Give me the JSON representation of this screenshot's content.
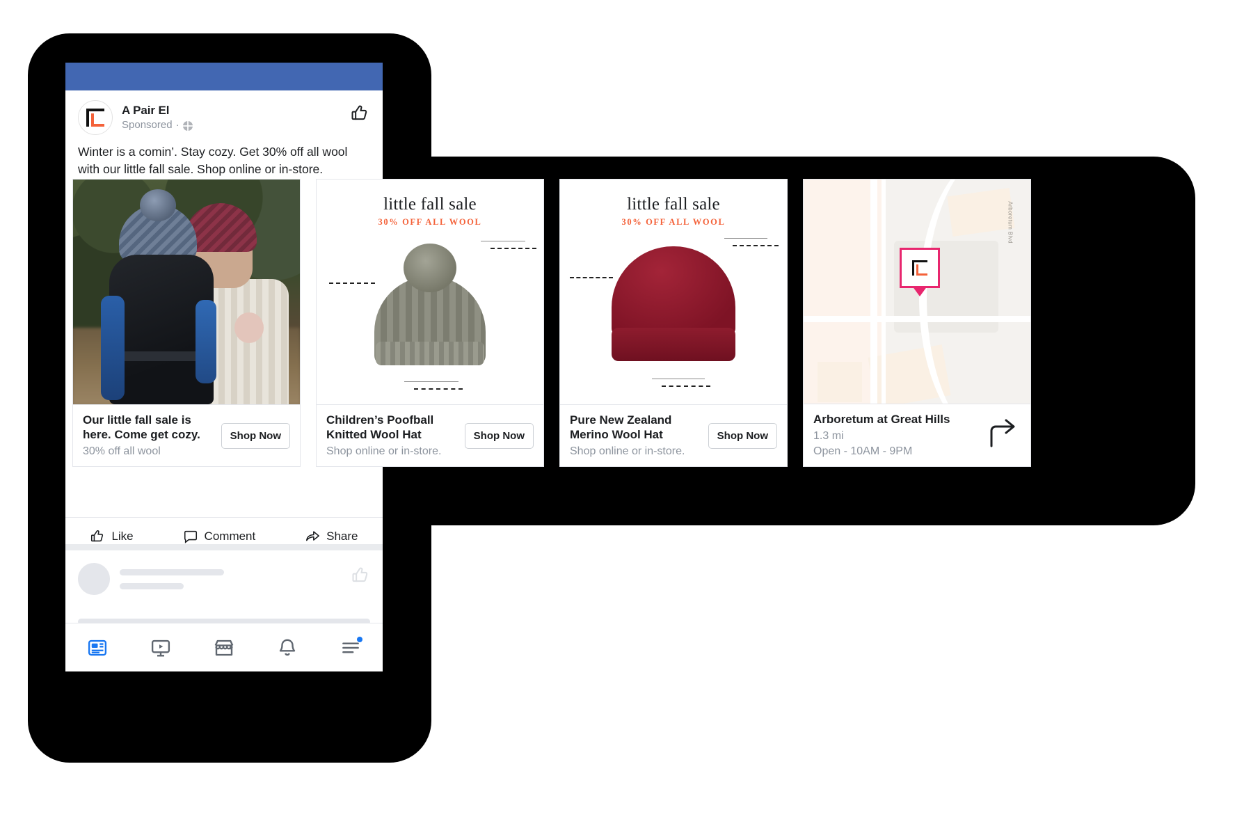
{
  "post": {
    "page_name": "A Pair El",
    "sponsored_label": "Sponsored",
    "sponsored_separator": "·",
    "globe_icon": "globe-icon",
    "thumbs_up_icon": "thumbs-up-icon",
    "caption": "Winter is a comin’. Stay cozy. Get 30% off all wool with our little fall sale. Shop online or in-store."
  },
  "cards": [
    {
      "kind": "photo",
      "title": "Our little fall sale is here. Come get cozy.",
      "subtitle": "30% off all wool",
      "cta": "Shop Now",
      "media_alt": "two-people-hiking-photo"
    },
    {
      "kind": "product",
      "sale_title": "little fall sale",
      "sale_sub": "30% OFF ALL WOOL",
      "title": "Children’s Poofball Knitted Wool Hat",
      "subtitle": "Shop online or in-store.",
      "cta": "Shop Now",
      "media_alt": "grey-pompom-beanie"
    },
    {
      "kind": "product",
      "sale_title": "little fall sale",
      "sale_sub": "30% OFF ALL WOOL",
      "title": "Pure New Zealand Merino Wool Hat",
      "subtitle": "Shop online or in-store.",
      "cta": "Shop Now",
      "media_alt": "red-merino-beanie"
    },
    {
      "kind": "map",
      "title": "Arboretum at Great Hills",
      "distance": "1.3 mi",
      "hours": "Open - 10AM - 9PM",
      "street_label": "Arboretum Blvd",
      "direction_icon": "turn-right-arrow-icon",
      "media_alt": "store-location-map"
    }
  ],
  "engagement": [
    {
      "label": "Like",
      "icon": "thumbs-up-icon"
    },
    {
      "label": "Comment",
      "icon": "comment-bubble-icon"
    },
    {
      "label": "Share",
      "icon": "share-arrow-icon"
    }
  ],
  "bottom_nav": [
    {
      "name": "news-feed",
      "icon": "news-feed-icon",
      "active": true
    },
    {
      "name": "watch",
      "icon": "watch-video-icon",
      "active": false
    },
    {
      "name": "marketplace",
      "icon": "marketplace-store-icon",
      "active": false
    },
    {
      "name": "notifications",
      "icon": "bell-icon",
      "active": false
    },
    {
      "name": "menu",
      "icon": "hamburger-menu-icon",
      "active": false
    }
  ],
  "colors": {
    "facebook_blue": "#4267b2",
    "accent_blue": "#1877f2",
    "brand_orange": "#f4623a",
    "pin_pink": "#e8266e",
    "text_primary": "#1c1e21",
    "text_muted": "#8d949e"
  }
}
